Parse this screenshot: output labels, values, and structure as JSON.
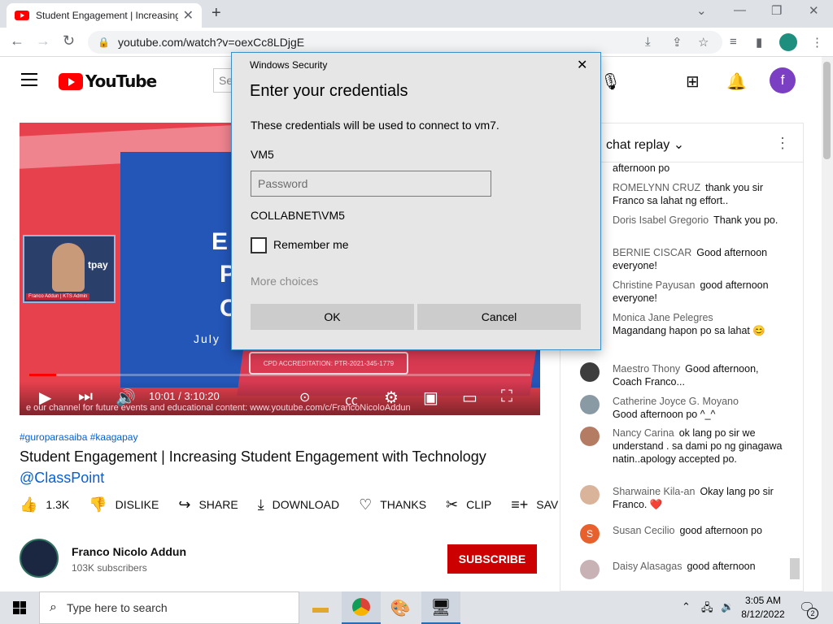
{
  "browser": {
    "tab_title": "Student Engagement | Increasing Student Engagement with Technology",
    "new_tab_label": "+",
    "url": "youtube.com/watch?v=oexCc8LDjgE",
    "window_controls": {
      "minimize": "—",
      "restore": "❐",
      "close": "✕",
      "chevron": "⌄"
    }
  },
  "youtube": {
    "logo_text": "YouTube",
    "search_placeholder": "Se",
    "user_initial": "f"
  },
  "video": {
    "time": "10:01 / 3:10:20",
    "progress_fraction": 0.053,
    "cam_label": "Franco Addun | KTS Admin",
    "cpd_text": "CPD ACCREDITATION: PTR-2021-345-1779",
    "ticker": "e our channel for future events and educational content: www.youtube.com/c/FrancoNicoloAddun",
    "slide_letters": [
      "E",
      "P",
      "C"
    ],
    "slide_date": "July",
    "cam_brand": "tpay"
  },
  "below_video": {
    "hashtags": "#guroparasaiba #kaagapay",
    "title": "Student Engagement | Increasing Student Engagement with Technology",
    "mention": "@ClassPoint",
    "actions": [
      {
        "icon": "thumbs-up-icon",
        "label": "1.3K"
      },
      {
        "icon": "thumbs-down-icon",
        "label": "DISLIKE"
      },
      {
        "icon": "share-icon",
        "label": "SHARE"
      },
      {
        "icon": "download-icon",
        "label": "DOWNLOAD"
      },
      {
        "icon": "thanks-icon",
        "label": "THANKS"
      },
      {
        "icon": "clip-icon",
        "label": "CLIP"
      },
      {
        "icon": "save-icon",
        "label": "SAV"
      }
    ],
    "channel_name": "Franco Nicolo Addun",
    "subscribers": "103K subscribers",
    "subscribe_label": "SUBSCRIBE"
  },
  "chat": {
    "title": "chat replay",
    "messages": [
      {
        "author": "",
        "text": "afternoon po"
      },
      {
        "author": "ROMELYNN CRUZ",
        "text": "thank you sir Franco sa lahat ng effort.."
      },
      {
        "author": "Doris Isabel Gregorio",
        "text": "Thank you po."
      },
      {
        "author": "BERNIE CISCAR",
        "text": "Good afternoon everyone!"
      },
      {
        "author": "Christine Payusan",
        "text": "good afternoon everyone!"
      },
      {
        "author": "Monica Jane Pelegres",
        "text": "Magandang hapon po sa lahat 😊"
      },
      {
        "author": "Maestro Thony",
        "text": "Good afternoon, Coach Franco..."
      },
      {
        "author": "Catherine Joyce G. Moyano",
        "text": "Good afternoon po ^_^"
      },
      {
        "author": "Nancy Carina",
        "text": "ok lang po sir we understand . sa dami po ng ginagawa natin..apology accepted po."
      },
      {
        "author": "Sharwaine Kila-an",
        "text": "Okay lang po sir Franco. ❤️"
      },
      {
        "author": "Susan Cecilio",
        "text": "good afternoon po"
      },
      {
        "author": "Daisy Alasagas",
        "text": "good afternoon"
      }
    ],
    "avatar_letter_susan": "S"
  },
  "dialog": {
    "caption": "Windows Security",
    "heading": "Enter your credentials",
    "message": "These credentials will be used to connect to vm7.",
    "user1": "VM5",
    "password_placeholder": "Password",
    "user2": "COLLABNET\\VM5",
    "remember_label": "Remember me",
    "more_choices": "More choices",
    "ok_label": "OK",
    "cancel_label": "Cancel"
  },
  "taskbar": {
    "search_placeholder": "Type here to search",
    "time": "3:05 AM",
    "date": "8/12/2022",
    "notification_count": "2"
  },
  "colors": {
    "youtube_red": "#ff0000",
    "subscribe_red": "#cc0000",
    "link_blue": "#065fd4",
    "dialog_border": "#3b8fc9"
  }
}
